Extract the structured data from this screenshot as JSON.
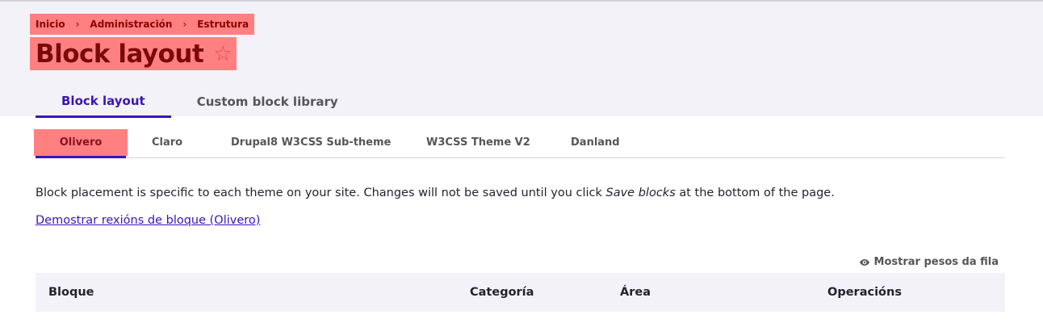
{
  "breadcrumb": {
    "items": [
      "Inicio",
      "Administración",
      "Estrutura"
    ],
    "separator": "›"
  },
  "page": {
    "title": "Block layout",
    "favorite_icon": "star-outline-icon"
  },
  "primary_tabs": [
    {
      "label": "Block layout",
      "active": true
    },
    {
      "label": "Custom block library",
      "active": false
    }
  ],
  "theme_tabs": [
    {
      "label": "Olivero",
      "active": true
    },
    {
      "label": "Claro",
      "active": false
    },
    {
      "label": "Drupal8 W3CSS Sub-theme",
      "active": false
    },
    {
      "label": "W3CSS Theme V2",
      "active": false
    },
    {
      "label": "Danland",
      "active": false
    }
  ],
  "description": {
    "before": "Block placement is specific to each theme on your site. Changes will not be saved until you click ",
    "emphasis": "Save blocks",
    "after": " at the bottom of the page."
  },
  "demo_link": "Demostrar rexións de bloque (Olivero)",
  "row_weights": {
    "label": "Mostrar pesos da fila",
    "icon": "eye-icon"
  },
  "table": {
    "headers": [
      "Bloque",
      "Categoría",
      "Área",
      "Operacións"
    ]
  },
  "colors": {
    "accent": "#3b14b8",
    "highlight": "#ff8080",
    "header_bg": "#f3f2f8"
  }
}
